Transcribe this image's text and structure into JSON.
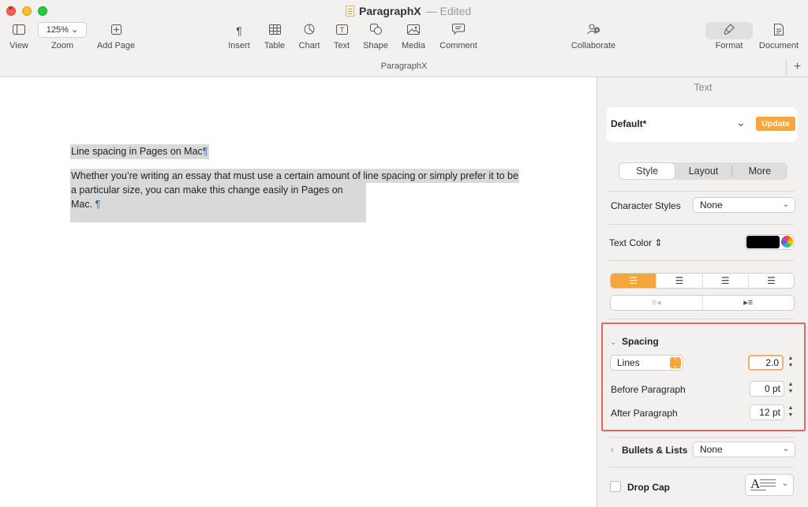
{
  "window": {
    "title": "ParagraphX",
    "status": "— Edited"
  },
  "toolbar": {
    "view": {
      "label": "View",
      "icon": "sidebar-icon"
    },
    "zoom": {
      "label": "Zoom",
      "value": "125%"
    },
    "add_page": {
      "label": "Add Page",
      "icon": "plus-square-icon"
    },
    "insert": {
      "label": "Insert",
      "icon": "pilcrow-icon"
    },
    "table": {
      "label": "Table",
      "icon": "table-icon"
    },
    "chart": {
      "label": "Chart",
      "icon": "chart-icon"
    },
    "text": {
      "label": "Text",
      "icon": "text-box-icon"
    },
    "shape": {
      "label": "Shape",
      "icon": "shape-icon"
    },
    "media": {
      "label": "Media",
      "icon": "photo-icon"
    },
    "comment": {
      "label": "Comment",
      "icon": "comment-icon"
    },
    "collaborate": {
      "label": "Collaborate",
      "icon": "collaborate-icon"
    },
    "format": {
      "label": "Format",
      "icon": "paintbrush-icon"
    },
    "document": {
      "label": "Document",
      "icon": "document-icon"
    }
  },
  "subtitle": "ParagraphX",
  "document": {
    "heading": "Line spacing in Pages on Mac",
    "body_line1": "Whether you’re writing an essay that must use a certain amount of line spacing or simply prefer it to be",
    "body_line2": "a particular size, you can make this change easily in Pages on Mac.",
    "pilcrow": "¶"
  },
  "inspector": {
    "header": "Text",
    "paragraph_style": "Default*",
    "update_label": "Update",
    "tabs": [
      "Style",
      "Layout",
      "More"
    ],
    "active_tab": "Style",
    "character_styles": {
      "label": "Character Styles",
      "value": "None"
    },
    "text_color": {
      "label": "Text Color",
      "color": "#000000"
    },
    "alignment": {
      "active": "left"
    },
    "spacing": {
      "label": "Spacing",
      "mode": "Lines",
      "value": "2.0",
      "before_label": "Before Paragraph",
      "before_value": "0 pt",
      "after_label": "After Paragraph",
      "after_value": "12 pt"
    },
    "bullets": {
      "label": "Bullets & Lists",
      "value": "None"
    },
    "drop_cap": {
      "label": "Drop Cap",
      "checked": false,
      "preview_letter": "A"
    }
  },
  "colors": {
    "accent": "#f7a63b",
    "highlight_border": "#e8675a",
    "pilcrow": "#2f5fd8"
  }
}
